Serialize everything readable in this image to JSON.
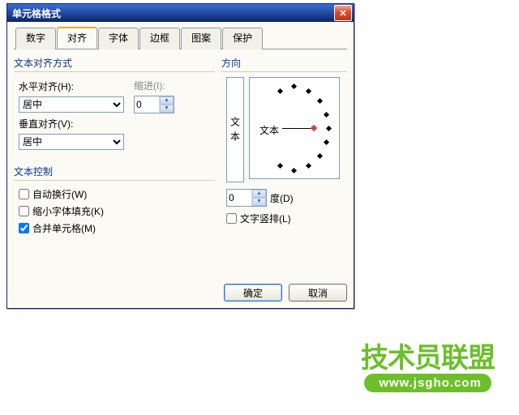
{
  "titlebar": {
    "title": "单元格格式"
  },
  "tabs": {
    "items": [
      {
        "label": "数字"
      },
      {
        "label": "对齐"
      },
      {
        "label": "字体"
      },
      {
        "label": "边框"
      },
      {
        "label": "图案"
      },
      {
        "label": "保护"
      }
    ],
    "active_index": 1
  },
  "align_group": {
    "title": "文本对齐方式",
    "h_label": "水平对齐(H):",
    "h_value": "居中",
    "indent_label": "缩进(I):",
    "indent_value": "0",
    "v_label": "垂直对齐(V):",
    "v_value": "居中"
  },
  "control_group": {
    "title": "文本控制",
    "wrap_label": "自动换行(W)",
    "wrap_checked": false,
    "shrink_label": "缩小字体填充(K)",
    "shrink_checked": false,
    "merge_label": "合并单元格(M)",
    "merge_checked": true
  },
  "orient_group": {
    "title": "方向",
    "vtext": "文本",
    "dial_text": "文本",
    "degree_value": "0",
    "degree_label": "度(D)",
    "stack_label": "文字竖排(L)",
    "stack_checked": false
  },
  "buttons": {
    "ok": "确定",
    "cancel": "取消"
  },
  "watermark": {
    "top": "技术员联盟",
    "bottom": "www.jsgho.com"
  }
}
